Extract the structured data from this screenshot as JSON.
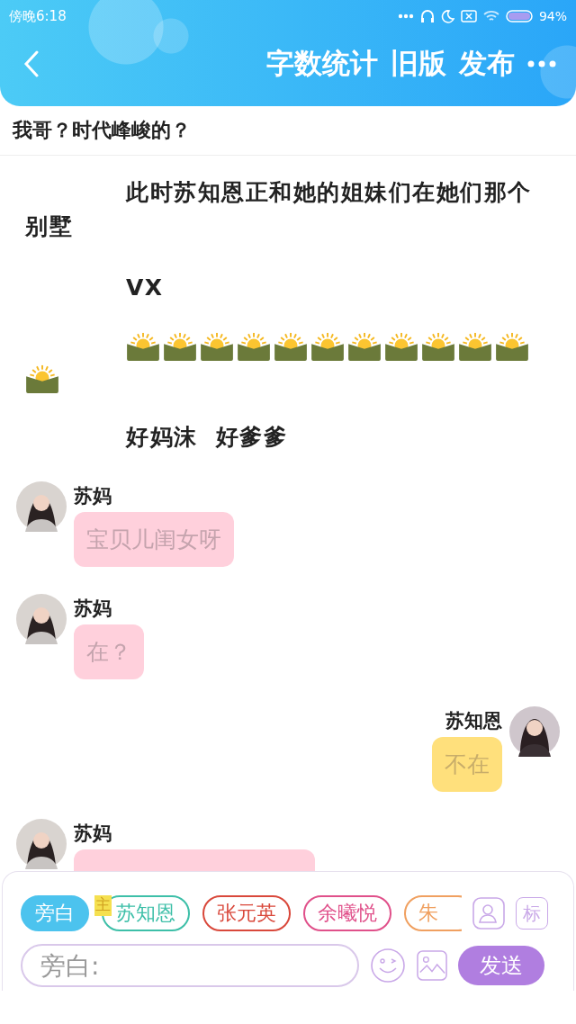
{
  "status_bar": {
    "time": "傍晚6:18",
    "battery": "94%"
  },
  "header": {
    "actions": [
      "字数统计",
      "旧版",
      "发布"
    ]
  },
  "chapter_title": "我哥？时代峰峻的？",
  "messages": [
    {
      "kind": "narration",
      "text": "此时苏知恩正和她的姐妹们在她们那个别墅"
    },
    {
      "kind": "narration",
      "text": "VX"
    },
    {
      "kind": "emoji_row"
    },
    {
      "kind": "narration",
      "text": "好妈沫  好爹爹"
    },
    {
      "kind": "incoming",
      "name": "苏妈",
      "text": "宝贝儿闺女呀"
    },
    {
      "kind": "incoming",
      "name": "苏妈",
      "text": "在？"
    },
    {
      "kind": "outgoing",
      "name": "苏知恩",
      "text": "不在"
    },
    {
      "kind": "incoming",
      "name": "苏妈"
    }
  ],
  "roles": [
    {
      "label": "旁白",
      "selected": true,
      "color": "#4cc3ee"
    },
    {
      "label": "苏知恩",
      "selected": false,
      "color": "#3dbfa8",
      "tag": "主"
    },
    {
      "label": "张元英",
      "selected": false,
      "color": "#d9483b"
    },
    {
      "label": "余曦悦",
      "selected": false,
      "color": "#e0508a"
    },
    {
      "label": "朱",
      "selected": false,
      "color": "#f0a060"
    }
  ],
  "mark_button": "标",
  "input": {
    "placeholder": "旁白:"
  },
  "send_button": "发送"
}
